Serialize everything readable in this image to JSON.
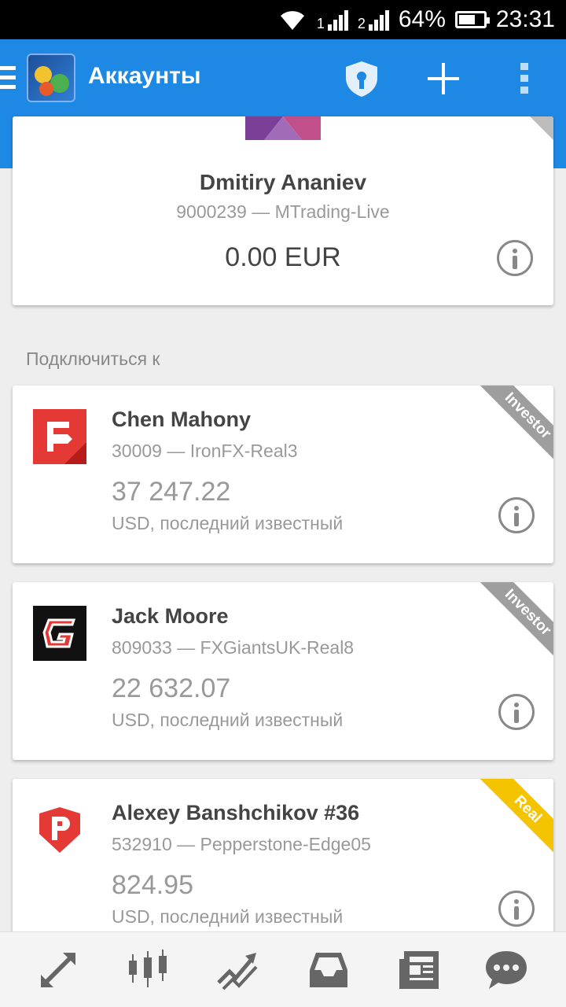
{
  "status_bar": {
    "net1": "1",
    "net2": "2",
    "battery": "64%",
    "time": "23:31"
  },
  "app_bar": {
    "title": "Аккаунты",
    "icons": [
      "menu-icon",
      "metatrader-logo",
      "shield-icon",
      "plus-icon",
      "more-vert-icon"
    ],
    "color": "#1e88e5"
  },
  "current_account": {
    "name": "Dmitiry Ananiev",
    "account": "9000239 — MTrading-Live",
    "balance": "0.00 EUR"
  },
  "section": {
    "label": "Подключиться к"
  },
  "accounts": [
    {
      "name": "Chen Mahony",
      "account": "30009 — IronFX-Real3",
      "balance": "37 247.22",
      "note": "USD, последний известный",
      "badge": "Investor",
      "badge_color": "#9e9e9e",
      "logo": "ironfx-logo"
    },
    {
      "name": "Jack Moore",
      "account": "809033 — FXGiantsUK-Real8",
      "balance": "22 632.07",
      "note": "USD, последний известный",
      "badge": "Investor",
      "badge_color": "#9e9e9e",
      "logo": "fxgiants-logo"
    },
    {
      "name": "Alexey Banshchikov #36",
      "account": "532910 — Pepperstone-Edge05",
      "balance": "824.95",
      "note": "USD, последний известный",
      "badge": "Real",
      "badge_color": "#f4c400",
      "logo": "pepperstone-logo"
    }
  ],
  "bottom_nav": [
    "quotes-icon",
    "chart-icon",
    "trade-icon",
    "history-icon",
    "news-icon",
    "chat-icon"
  ]
}
